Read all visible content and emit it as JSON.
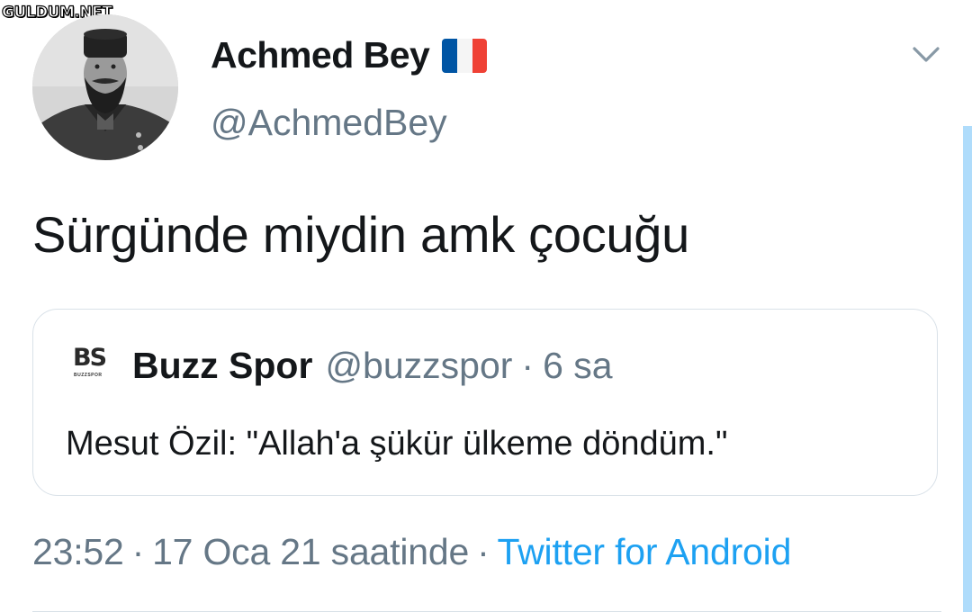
{
  "watermark": "GULDUM.NET",
  "tweet": {
    "display_name": "Achmed Bey",
    "flag_icon": "flag-france-icon",
    "handle": "@AchmedBey",
    "text": "Sürgünde miydin amk çocuğu",
    "time": "23:52",
    "date": "17 Oca 21 saatinde",
    "separator": "·",
    "source": "Twitter for Android"
  },
  "quoted_tweet": {
    "logo_text": "BS",
    "logo_subtext": "BUZZSPOR",
    "name": "Buzz Spor",
    "handle": "@buzzspor",
    "separator": "·",
    "time_ago": "6 sa",
    "text": "Mesut Özil: \"Allah'a şükür ülkeme döndüm.\""
  },
  "colors": {
    "primary_text": "#14171a",
    "secondary_text": "#657786",
    "link": "#1da1f2",
    "border": "#d9e1e8",
    "scrollbar": "#afdcfb"
  }
}
